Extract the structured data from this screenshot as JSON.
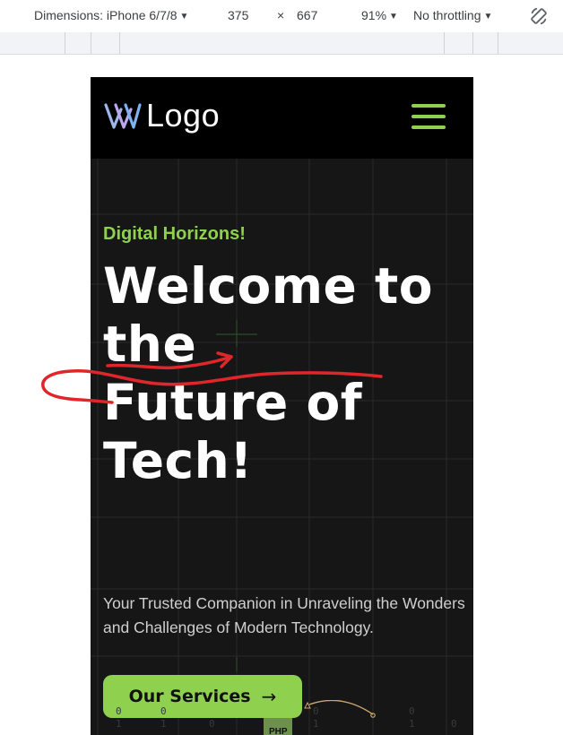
{
  "devtools": {
    "device": "Dimensions: iPhone 6/7/8",
    "width": "375",
    "times": "×",
    "height": "667",
    "zoom": "91%",
    "throttling": "No throttling",
    "rotate_icon": "rotate-icon"
  },
  "site": {
    "logo_text": "Logo",
    "menu_icon": "hamburger-menu-icon"
  },
  "hero": {
    "eyebrow": "Digital Horizons!",
    "headline_lines": [
      "Welcome to",
      "the",
      "Future of",
      "Tech!"
    ],
    "subtext": "Your Trusted Companion in Unraveling the Wonders and Challenges of Modern Technology.",
    "cta_label": "Our Services",
    "cta_arrow": "→",
    "deco_badge": "PHP"
  },
  "colors": {
    "accent": "#8fd14f",
    "header_bg": "#000000",
    "hero_bg": "#161616",
    "annotation": "#e0262a"
  }
}
